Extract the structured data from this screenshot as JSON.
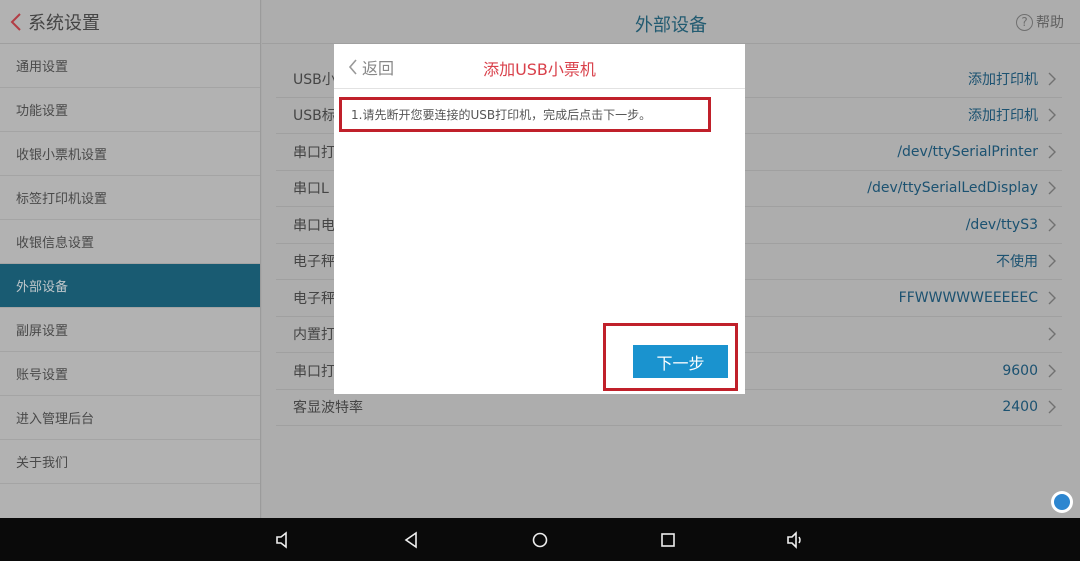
{
  "sidebar": {
    "title": "系统设置",
    "items": [
      {
        "label": "通用设置",
        "active": false
      },
      {
        "label": "功能设置",
        "active": false
      },
      {
        "label": "收银小票机设置",
        "active": false
      },
      {
        "label": "标签打印机设置",
        "active": false
      },
      {
        "label": "收银信息设置",
        "active": false
      },
      {
        "label": "外部设备",
        "active": true
      },
      {
        "label": "副屏设置",
        "active": false
      },
      {
        "label": "账号设置",
        "active": false
      },
      {
        "label": "进入管理后台",
        "active": false
      },
      {
        "label": "关于我们",
        "active": false
      }
    ]
  },
  "header": {
    "title": "外部设备",
    "help_label": "帮助"
  },
  "rows": [
    {
      "label": "USB小",
      "value": "添加打印机"
    },
    {
      "label": "USB标",
      "value": "添加打印机"
    },
    {
      "label": "串口打",
      "value": "/dev/ttySerialPrinter"
    },
    {
      "label": "串口L",
      "value": "/dev/ttySerialLedDisplay"
    },
    {
      "label": "串口电",
      "value": "/dev/ttyS3"
    },
    {
      "label": "电子秤",
      "value": "不使用"
    },
    {
      "label": "电子秤",
      "value": "FFWWWWWEEEEEC"
    },
    {
      "label": "内置打",
      "value": ""
    },
    {
      "label": "串口打",
      "value": "9600"
    },
    {
      "label": "客显波特率",
      "value": "2400"
    }
  ],
  "modal": {
    "back_label": "返回",
    "title": "添加USB小票机",
    "step_text": "1.请先断开您要连接的USB打印机，完成后点击下一步。",
    "next_label": "下一步"
  },
  "colors": {
    "accent": "#1f6f8c",
    "button": "#1a93cf",
    "highlight": "#c0202a",
    "modal_title": "#d9414b"
  },
  "icons": [
    "chevron-left-icon",
    "help-icon",
    "chevron-right-icon",
    "volume-down-icon",
    "back-icon",
    "home-icon",
    "recents-icon",
    "volume-up-icon",
    "floating-assistant-icon"
  ]
}
